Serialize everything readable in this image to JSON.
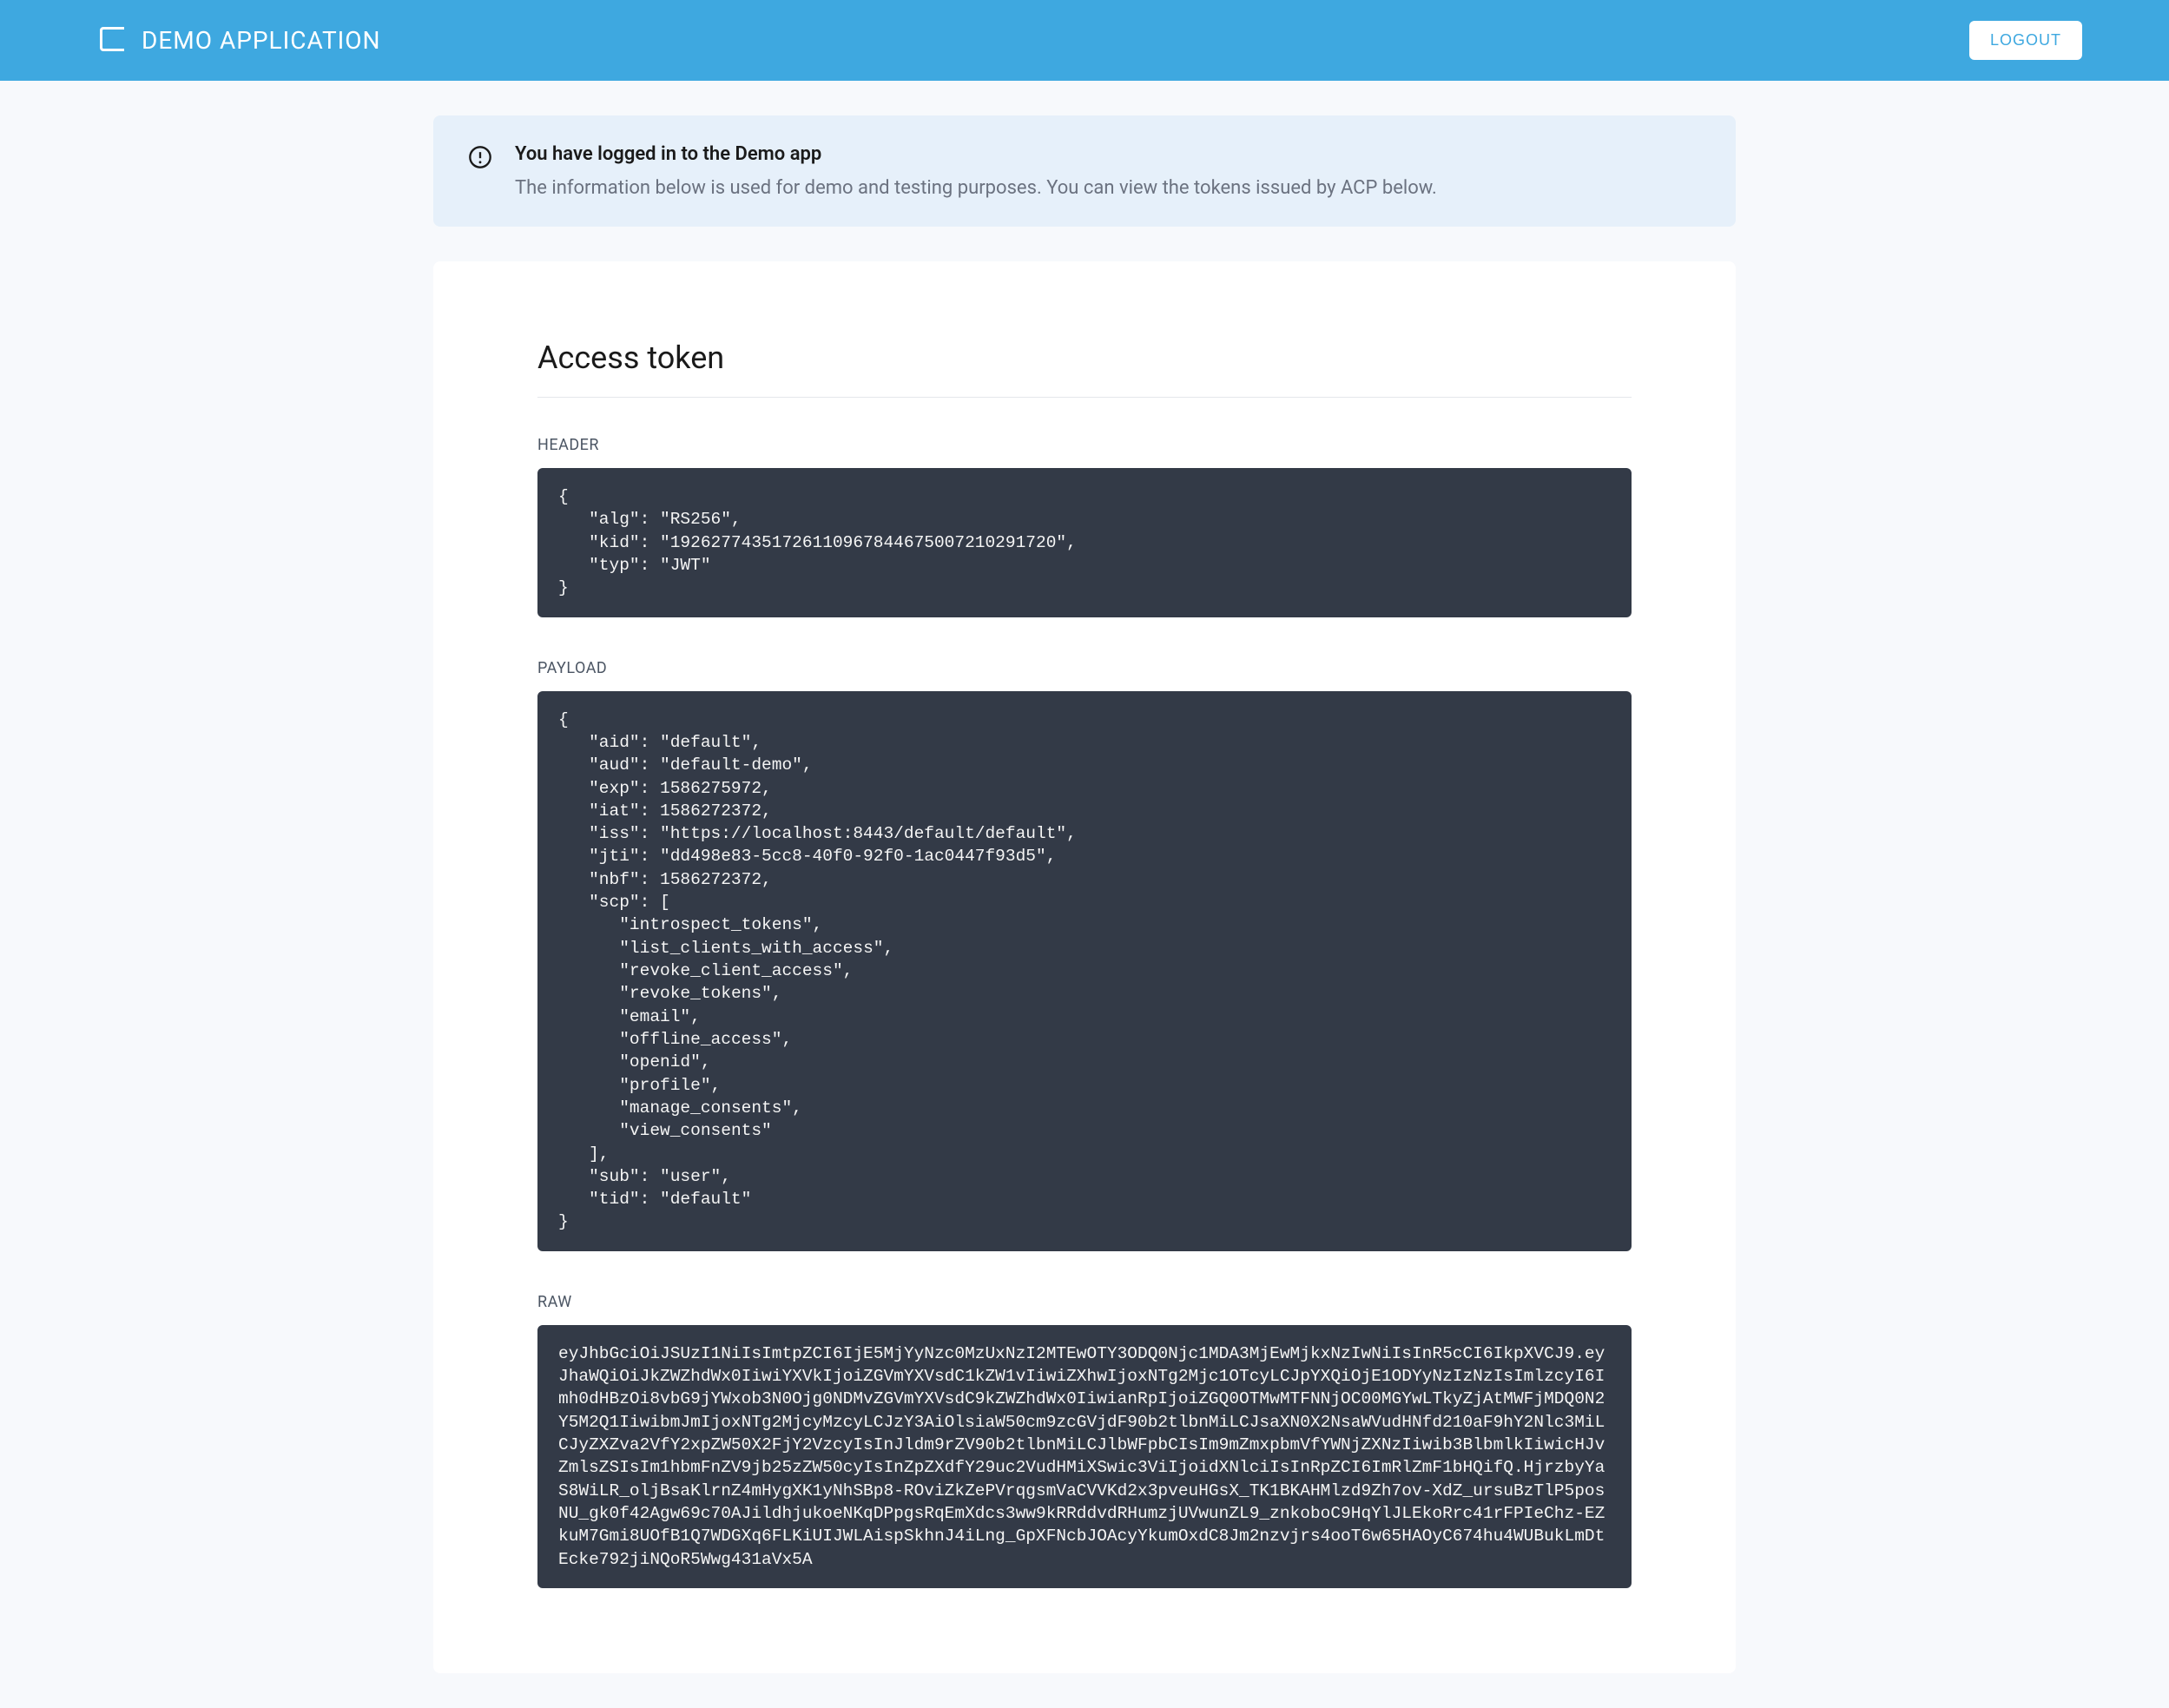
{
  "header": {
    "app_title": "DEMO APPLICATION",
    "logout_label": "LOGOUT"
  },
  "banner": {
    "title": "You have logged in to the Demo app",
    "description": "The information below is used for demo and testing purposes. You can view the tokens issued by ACP below."
  },
  "access_token": {
    "title": "Access token",
    "header_label": "HEADER",
    "header_code": "{\n   \"alg\": \"RS256\",\n   \"kid\": \"19262774351726110967844675007210291720\",\n   \"typ\": \"JWT\"\n}",
    "payload_label": "PAYLOAD",
    "payload_code": "{\n   \"aid\": \"default\",\n   \"aud\": \"default-demo\",\n   \"exp\": 1586275972,\n   \"iat\": 1586272372,\n   \"iss\": \"https://localhost:8443/default/default\",\n   \"jti\": \"dd498e83-5cc8-40f0-92f0-1ac0447f93d5\",\n   \"nbf\": 1586272372,\n   \"scp\": [\n      \"introspect_tokens\",\n      \"list_clients_with_access\",\n      \"revoke_client_access\",\n      \"revoke_tokens\",\n      \"email\",\n      \"offline_access\",\n      \"openid\",\n      \"profile\",\n      \"manage_consents\",\n      \"view_consents\"\n   ],\n   \"sub\": \"user\",\n   \"tid\": \"default\"\n}",
    "raw_label": "RAW",
    "raw_code": "eyJhbGciOiJSUzI1NiIsImtpZCI6IjE5MjYyNzc0MzUxNzI2MTEwOTY3ODQ0Njc1MDA3MjEwMjkxNzIwNiIsInR5cCI6IkpXVCJ9.eyJhaWQiOiJkZWZhdWx0IiwiYXVkIjoiZGVmYXVsdC1kZW1vIiwiZXhwIjoxNTg2Mjc1OTcyLCJpYXQiOjE1ODYyNzIzNzIsImlzcyI6Imh0dHBzOi8vbG9jYWxob3N0Ojg0NDMvZGVmYXVsdC9kZWZhdWx0IiwianRpIjoiZGQ0OTMwMTFNNjOC00MGYwLTkyZjAtMWFjMDQ0N2Y5M2Q1IiwibmJmIjoxNTg2MjcyMzcyLCJzY3AiOlsiaW50cm9zcGVjdF90b2tlbnMiLCJsaXN0X2NsaWVudHNfd210aF9hY2Nlc3MiLCJyZXZva2VfY2xpZW50X2FjY2VzcyIsInJldm9rZV90b2tlbnMiLCJlbWFpbCIsIm9mZmxpbmVfYWNjZXNzIiwib3BlbmlkIiwicHJvZmlsZSIsIm1hbmFnZV9jb25zZW50cyIsInZpZXdfY29uc2VudHMiXSwic3ViIjoidXNlciIsInRpZCI6ImRlZmF1bHQifQ.HjrzbyYaS8WiLR_oljBsaKlrnZ4mHygXK1yNhSBp8-ROviZkZePVrqgsmVaCVVKd2x3pveuHGsX_TK1BKAHMlzd9Zh7ov-XdZ_ursuBzTlP5posNU_gk0f42Agw69c70AJildhjukoeNKqDPpgsRqEmXdcs3ww9kRRddvdRHumzjUVwunZL9_znkoboC9HqYlJLEkoRrc41rFPIeChz-EZkuM7Gmi8UOfB1Q7WDGXq6FLKiUIJWLAispSkhnJ4iLng_GpXFNcbJOAcyYkumOxdC8Jm2nzvjrs4ooT6w65HAOyC674hu4WUBukLmDtEcke792jiNQoR5Wwg431aVx5A"
  }
}
